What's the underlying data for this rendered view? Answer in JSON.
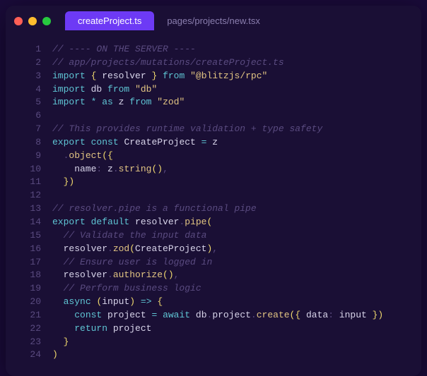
{
  "tabs": {
    "active": "createProject.ts",
    "inactive": "pages/projects/new.tsx"
  },
  "code": {
    "lines": [
      {
        "n": "1",
        "seg": [
          {
            "c": "comment",
            "t": "// ---- ON THE SERVER ----"
          }
        ]
      },
      {
        "n": "2",
        "seg": [
          {
            "c": "comment",
            "t": "// app/projects/mutations/createProject.ts"
          }
        ]
      },
      {
        "n": "3",
        "seg": [
          {
            "c": "kw",
            "t": "import"
          },
          {
            "c": "id",
            "t": " "
          },
          {
            "c": "bracket",
            "t": "{"
          },
          {
            "c": "id",
            "t": " resolver "
          },
          {
            "c": "bracket",
            "t": "}"
          },
          {
            "c": "id",
            "t": " "
          },
          {
            "c": "kw",
            "t": "from"
          },
          {
            "c": "id",
            "t": " "
          },
          {
            "c": "str",
            "t": "\"@blitzjs/rpc\""
          }
        ]
      },
      {
        "n": "4",
        "seg": [
          {
            "c": "kw",
            "t": "import"
          },
          {
            "c": "id",
            "t": " db "
          },
          {
            "c": "kw",
            "t": "from"
          },
          {
            "c": "id",
            "t": " "
          },
          {
            "c": "str",
            "t": "\"db\""
          }
        ]
      },
      {
        "n": "5",
        "seg": [
          {
            "c": "kw",
            "t": "import"
          },
          {
            "c": "id",
            "t": " "
          },
          {
            "c": "op",
            "t": "*"
          },
          {
            "c": "id",
            "t": " "
          },
          {
            "c": "kw",
            "t": "as"
          },
          {
            "c": "id",
            "t": " z "
          },
          {
            "c": "kw",
            "t": "from"
          },
          {
            "c": "id",
            "t": " "
          },
          {
            "c": "str",
            "t": "\"zod\""
          }
        ]
      },
      {
        "n": "6",
        "seg": []
      },
      {
        "n": "7",
        "seg": [
          {
            "c": "comment",
            "t": "// This provides runtime validation + type safety"
          }
        ]
      },
      {
        "n": "8",
        "seg": [
          {
            "c": "kw",
            "t": "export"
          },
          {
            "c": "id",
            "t": " "
          },
          {
            "c": "kw",
            "t": "const"
          },
          {
            "c": "id",
            "t": " CreateProject "
          },
          {
            "c": "op",
            "t": "="
          },
          {
            "c": "id",
            "t": " z"
          }
        ]
      },
      {
        "n": "9",
        "seg": [
          {
            "c": "id",
            "t": "  "
          },
          {
            "c": "punc",
            "t": "."
          },
          {
            "c": "func",
            "t": "object"
          },
          {
            "c": "paren",
            "t": "("
          },
          {
            "c": "bracket",
            "t": "{"
          }
        ]
      },
      {
        "n": "10",
        "seg": [
          {
            "c": "id",
            "t": "    name"
          },
          {
            "c": "punc",
            "t": ":"
          },
          {
            "c": "id",
            "t": " z"
          },
          {
            "c": "punc",
            "t": "."
          },
          {
            "c": "func",
            "t": "string"
          },
          {
            "c": "paren",
            "t": "()"
          },
          {
            "c": "punc",
            "t": ","
          }
        ]
      },
      {
        "n": "11",
        "seg": [
          {
            "c": "id",
            "t": "  "
          },
          {
            "c": "bracket",
            "t": "}"
          },
          {
            "c": "paren",
            "t": ")"
          }
        ]
      },
      {
        "n": "12",
        "seg": []
      },
      {
        "n": "13",
        "seg": [
          {
            "c": "comment",
            "t": "// resolver.pipe is a functional pipe"
          }
        ]
      },
      {
        "n": "14",
        "seg": [
          {
            "c": "kw",
            "t": "export"
          },
          {
            "c": "id",
            "t": " "
          },
          {
            "c": "kw",
            "t": "default"
          },
          {
            "c": "id",
            "t": " resolver"
          },
          {
            "c": "punc",
            "t": "."
          },
          {
            "c": "func",
            "t": "pipe"
          },
          {
            "c": "paren",
            "t": "("
          }
        ]
      },
      {
        "n": "15",
        "seg": [
          {
            "c": "id",
            "t": "  "
          },
          {
            "c": "comment",
            "t": "// Validate the input data"
          }
        ]
      },
      {
        "n": "16",
        "seg": [
          {
            "c": "id",
            "t": "  resolver"
          },
          {
            "c": "punc",
            "t": "."
          },
          {
            "c": "func",
            "t": "zod"
          },
          {
            "c": "paren",
            "t": "("
          },
          {
            "c": "id",
            "t": "CreateProject"
          },
          {
            "c": "paren",
            "t": ")"
          },
          {
            "c": "punc",
            "t": ","
          }
        ]
      },
      {
        "n": "17",
        "seg": [
          {
            "c": "id",
            "t": "  "
          },
          {
            "c": "comment",
            "t": "// Ensure user is logged in"
          }
        ]
      },
      {
        "n": "18",
        "seg": [
          {
            "c": "id",
            "t": "  resolver"
          },
          {
            "c": "punc",
            "t": "."
          },
          {
            "c": "func",
            "t": "authorize"
          },
          {
            "c": "paren",
            "t": "()"
          },
          {
            "c": "punc",
            "t": ","
          }
        ]
      },
      {
        "n": "19",
        "seg": [
          {
            "c": "id",
            "t": "  "
          },
          {
            "c": "comment",
            "t": "// Perform business logic"
          }
        ]
      },
      {
        "n": "20",
        "seg": [
          {
            "c": "id",
            "t": "  "
          },
          {
            "c": "kw",
            "t": "async"
          },
          {
            "c": "id",
            "t": " "
          },
          {
            "c": "paren",
            "t": "("
          },
          {
            "c": "param",
            "t": "input"
          },
          {
            "c": "paren",
            "t": ")"
          },
          {
            "c": "id",
            "t": " "
          },
          {
            "c": "op",
            "t": "=>"
          },
          {
            "c": "id",
            "t": " "
          },
          {
            "c": "bracket",
            "t": "{"
          }
        ]
      },
      {
        "n": "21",
        "seg": [
          {
            "c": "id",
            "t": "    "
          },
          {
            "c": "kw",
            "t": "const"
          },
          {
            "c": "id",
            "t": " project "
          },
          {
            "c": "op",
            "t": "="
          },
          {
            "c": "id",
            "t": " "
          },
          {
            "c": "kw",
            "t": "await"
          },
          {
            "c": "id",
            "t": " db"
          },
          {
            "c": "punc",
            "t": "."
          },
          {
            "c": "id",
            "t": "project"
          },
          {
            "c": "punc",
            "t": "."
          },
          {
            "c": "func",
            "t": "create"
          },
          {
            "c": "paren",
            "t": "("
          },
          {
            "c": "bracket",
            "t": "{"
          },
          {
            "c": "id",
            "t": " data"
          },
          {
            "c": "punc",
            "t": ":"
          },
          {
            "c": "id",
            "t": " input "
          },
          {
            "c": "bracket",
            "t": "}"
          },
          {
            "c": "paren",
            "t": ")"
          }
        ]
      },
      {
        "n": "22",
        "seg": [
          {
            "c": "id",
            "t": "    "
          },
          {
            "c": "kw",
            "t": "return"
          },
          {
            "c": "id",
            "t": " project"
          }
        ]
      },
      {
        "n": "23",
        "seg": [
          {
            "c": "id",
            "t": "  "
          },
          {
            "c": "bracket",
            "t": "}"
          }
        ]
      },
      {
        "n": "24",
        "seg": [
          {
            "c": "paren",
            "t": ")"
          }
        ]
      }
    ]
  }
}
